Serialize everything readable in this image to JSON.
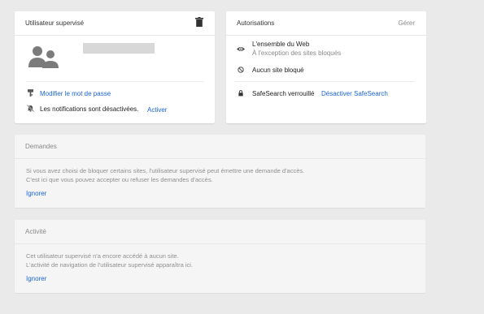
{
  "supervised_user": {
    "title": "Utilisateur supervisé",
    "change_password": "Modifier le mot de passe",
    "notifications_text": "Les notifications sont désactivées.",
    "notifications_action": "Activer"
  },
  "permissions": {
    "title": "Autorisations",
    "manage": "Gérer",
    "web_title": "L'ensemble du Web",
    "web_subtitle": "À l'exception des sites bloqués",
    "blocked": "Aucun site bloqué",
    "safesearch": "SafeSearch verrouillé",
    "safesearch_action": "Désactiver SafeSearch"
  },
  "requests": {
    "title": "Demandes",
    "line1": "Si vous avez choisi de bloquer certains sites, l'utilisateur supervisé peut émettre une demande d'accès.",
    "line2": "C'est ici que vous pouvez accepter ou refuser les demandes d'accès.",
    "ignore": "Ignorer"
  },
  "activity": {
    "title": "Activité",
    "line1": "Cet utilisateur supervisé n'a encore accédé à aucun site.",
    "line2": "L'activité de navigation de l'utilisateur supervisé apparaîtra ici.",
    "ignore": "Ignorer"
  },
  "colors": {
    "link": "#1a64d6",
    "background": "#eaeaea"
  },
  "icons": [
    "trash-icon",
    "avatar-icon",
    "key-icon",
    "bell-off-icon",
    "eye-icon",
    "block-icon",
    "lock-icon"
  ]
}
